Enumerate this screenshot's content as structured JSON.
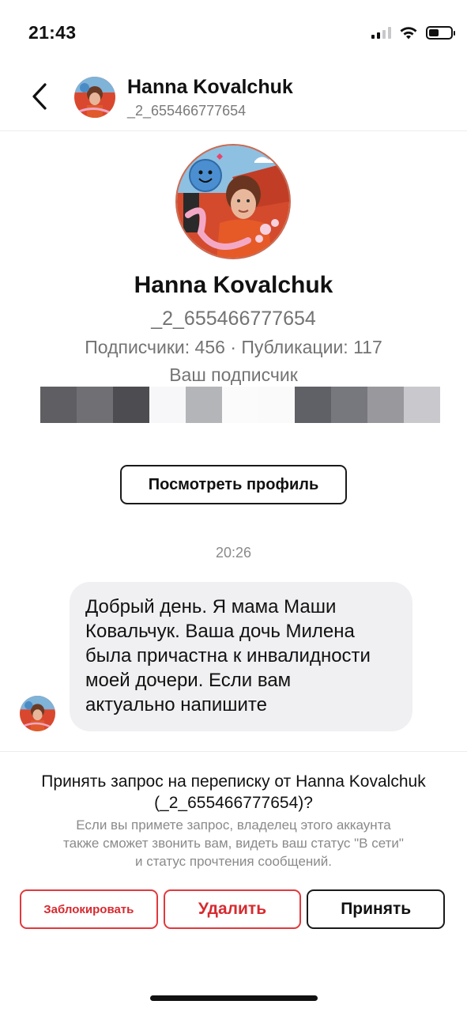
{
  "status_bar": {
    "time": "21:43",
    "signal_icon": "cellular-signal-icon",
    "wifi_icon": "wifi-icon",
    "battery_icon": "battery-icon",
    "battery_level": 0.45
  },
  "header": {
    "back_icon": "chevron-left-icon",
    "name": "Hanna Kovalchuk",
    "handle": "_2_655466777654"
  },
  "profile": {
    "name": "Hanna Kovalchuk",
    "handle": "_2_655466777654",
    "stats": "Подписчики: 456 · Публикации: 117",
    "follow_status": "Ваш подписчик",
    "mosaic_colors": [
      "#5f5f63",
      "#6f6f74",
      "#4c4c51",
      "#f7f7f9",
      "#b3b5b8",
      "#fbfbfc",
      "#fafafb",
      "#606067",
      "#77787d",
      "#98989d",
      "#c9c9cd"
    ],
    "view_profile_label": "Посмотреть профиль"
  },
  "conversation": {
    "timestamp": "20:26",
    "messages": [
      {
        "line1": "Добрый день. Я мама Маши",
        "line2": "Ковальчук. Ваша дочь Милена",
        "line3": "была причастна к инвалидности",
        "line4": "моей дочери. Если вам",
        "line5": "актуально напишите"
      }
    ]
  },
  "request": {
    "title_line1": "Принять запрос на переписку от Hanna Kovalchuk",
    "title_line2": "(_2_655466777654)?",
    "desc_line1": "Если вы примете запрос, владелец этого аккаунта",
    "desc_line2": "также сможет звонить вам, видеть ваш статус \"В сети\"",
    "desc_line3": "и статус прочтения сообщений.",
    "block_label": "Заблокировать",
    "delete_label": "Удалить",
    "accept_label": "Принять"
  },
  "colors": {
    "danger": "#d62a2f",
    "muted_text": "#737373",
    "bubble_bg": "#f0f0f2"
  }
}
